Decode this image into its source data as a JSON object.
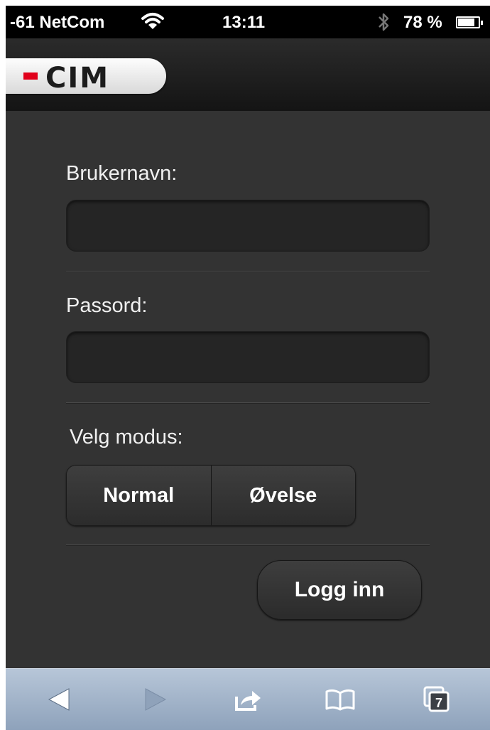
{
  "status_bar": {
    "carrier": "-61 NetCom",
    "time": "13:11",
    "battery": "78 %",
    "battery_level": 0.78
  },
  "header": {
    "logo_text": "CIM"
  },
  "form": {
    "username_label": "Brukernavn:",
    "username_value": "",
    "password_label": "Passord:",
    "password_value": "",
    "mode_label": "Velg modus:",
    "modes": [
      "Normal",
      "Øvelse"
    ],
    "login_button": "Logg inn"
  },
  "toolbar": {
    "icons": [
      "back-icon",
      "forward-icon",
      "share-icon",
      "bookmarks-icon",
      "tabs-icon"
    ],
    "tab_count": "7"
  },
  "colors": {
    "background": "#333333",
    "brand_red": "#e1001a",
    "toolbar": "#a3b4c9"
  }
}
